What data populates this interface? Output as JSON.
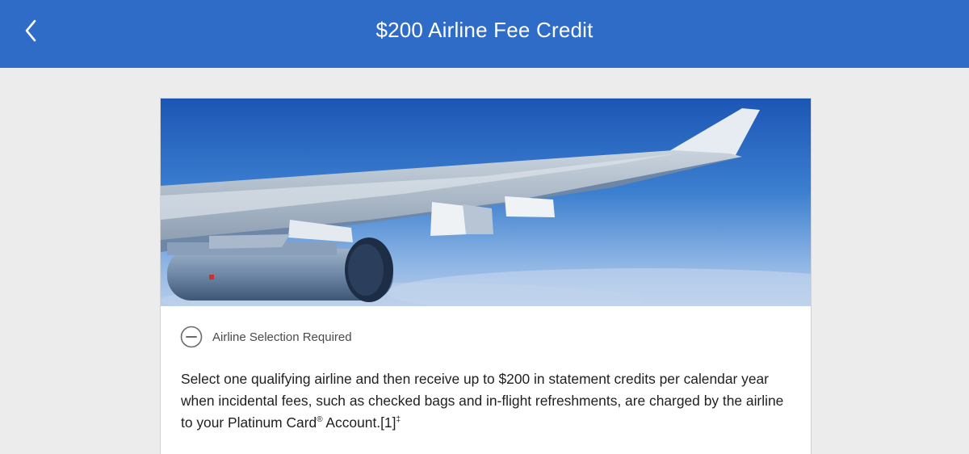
{
  "header": {
    "title": "$200 Airline Fee Credit",
    "back_icon": "chevron-left-icon",
    "background": "#2f6cc8"
  },
  "card": {
    "hero_image": "airplane wing above clouds",
    "status": {
      "icon": "minus-circle-icon",
      "label": "Airline Selection Required"
    },
    "description": {
      "main": "Select one qualifying airline and then receive up to $200 in statement credits per calendar year when incidental fees, such as checked bags and in-flight refreshments, are charged by the airline to your Platinum Card",
      "reg_mark": "®",
      "after_mark": " Account.[1]",
      "footnote_mark": "‡"
    }
  }
}
